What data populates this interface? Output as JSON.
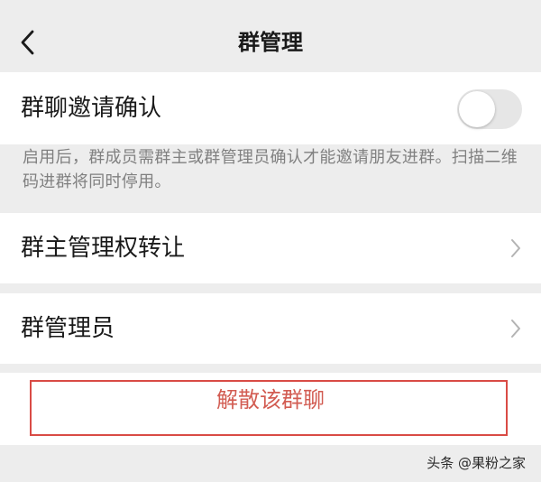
{
  "nav": {
    "title": "群管理",
    "back_icon": "chevron-left-icon"
  },
  "invite_confirm": {
    "label": "群聊邀请确认",
    "toggle_on": false,
    "hint": "启用后，群成员需群主或群管理员确认才能邀请朋友进群。扫描二维码进群将同时停用。"
  },
  "transfer_owner": {
    "label": "群主管理权转让",
    "icon": "chevron-right-icon"
  },
  "admins": {
    "label": "群管理员",
    "icon": "chevron-right-icon"
  },
  "dissolve": {
    "label": "解散该群聊",
    "color": "#d25c52",
    "highlight_color": "#d94b45"
  },
  "watermark": {
    "text": "头条 @果粉之家"
  },
  "colors": {
    "background": "#ededed",
    "cell": "#ffffff",
    "hint_text": "#808080"
  }
}
